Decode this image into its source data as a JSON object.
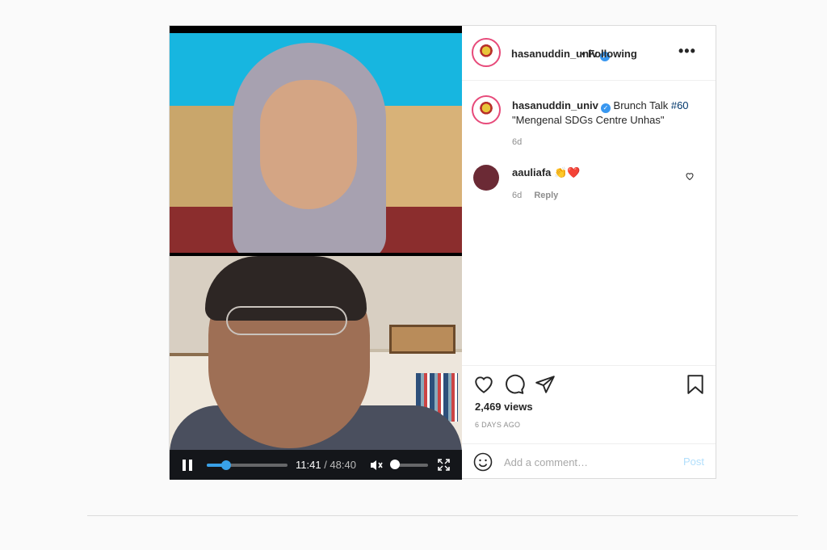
{
  "post": {
    "account": "hasanuddin_univ",
    "follow_status": "• Following",
    "more_label": "•••",
    "caption_text": "Brunch Talk",
    "caption_hashtag": "#60",
    "caption_line2": "\"Mengenal SDGs Centre Unhas\"",
    "caption_age": "6d"
  },
  "video": {
    "current_time": "11:41",
    "total_time": "/ 48:40",
    "progress_fraction": 0.24,
    "volume_fraction": 0.07
  },
  "comment": {
    "username": "aauliafa",
    "text": "👏❤️",
    "age": "6d",
    "reply_label": "Reply"
  },
  "stats": {
    "views": "2,469 views",
    "time_ago": "6 DAYS AGO"
  },
  "comment_box": {
    "placeholder": "Add a comment…",
    "post_label": "Post"
  },
  "colors": {
    "accent": "#3897f0",
    "progress": "#39a1e8",
    "post_disabled": "#b2dffc",
    "story_ring": "#e74a7a"
  }
}
